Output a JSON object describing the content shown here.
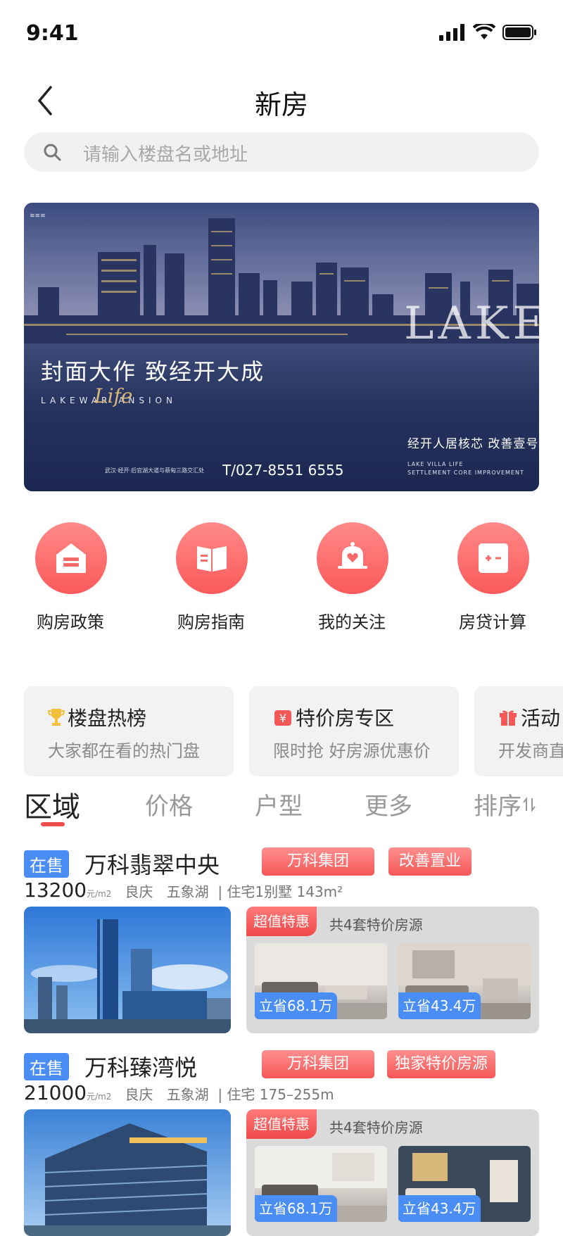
{
  "status_bar": {
    "time": "9:41"
  },
  "header": {
    "title": "新房"
  },
  "search": {
    "placeholder": "请输入楼盘名或地址"
  },
  "banner": {
    "headline": "封面大作  致经开大成",
    "subline": "LAKEWAR   ANSION",
    "script_word": "Life",
    "big_text": "LAKEW",
    "tag_main": "经开人居核芯 改善壹号",
    "tag_en": "LAKE VILLA LIFE\nSETTLEMENT CORE IMPROVEMENT",
    "tel": "T/027-8551 6555",
    "address": "武汉·经开·后官湖大道与蔡甸三路交汇处"
  },
  "quick_menu": [
    {
      "label": "购房政策",
      "icon": "policy-house-icon"
    },
    {
      "label": "购房指南",
      "icon": "guide-book-icon"
    },
    {
      "label": "我的关注",
      "icon": "bell-heart-icon"
    },
    {
      "label": "房贷计算",
      "icon": "calculator-icon"
    }
  ],
  "promo_cards": [
    {
      "title": "楼盘热榜",
      "subtitle": "大家都在看的热门盘",
      "icon": "trophy-icon"
    },
    {
      "title": "特价房专区",
      "subtitle": "限时抢 好房源优惠价",
      "icon": "yen-tag-icon"
    },
    {
      "title": "活动",
      "subtitle": "开发商直",
      "icon": "gift-icon"
    }
  ],
  "filter_tabs": [
    "区域",
    "价格",
    "户型",
    "更多",
    "排序"
  ],
  "listings": [
    {
      "status": "在售",
      "name": "万科翡翠中央",
      "tags": [
        "万科集团",
        "改善置业"
      ],
      "price": "13200",
      "unit": "元/m2",
      "district": "良庆",
      "area_name": "五象湖",
      "type_info": "住宅1别墅 143m²",
      "deal_tag": "超值特惠",
      "deal_text": "共4套特价房源",
      "savings": [
        "立省68.1万",
        "立省43.4万"
      ]
    },
    {
      "status": "在售",
      "name": "万科臻湾悦",
      "tags": [
        "万科集团",
        "独家特价房源"
      ],
      "price": "21000",
      "unit": "元/m2",
      "district": "良庆",
      "area_name": "五象湖",
      "type_info": "住宅  175–255m",
      "deal_tag": "超值特惠",
      "deal_text": "共4套特价房源",
      "savings": [
        "立省68.1万",
        "立省43.4万"
      ]
    }
  ],
  "colors": {
    "accent_red": "#f65757",
    "badge_blue": "#4a8df5"
  }
}
